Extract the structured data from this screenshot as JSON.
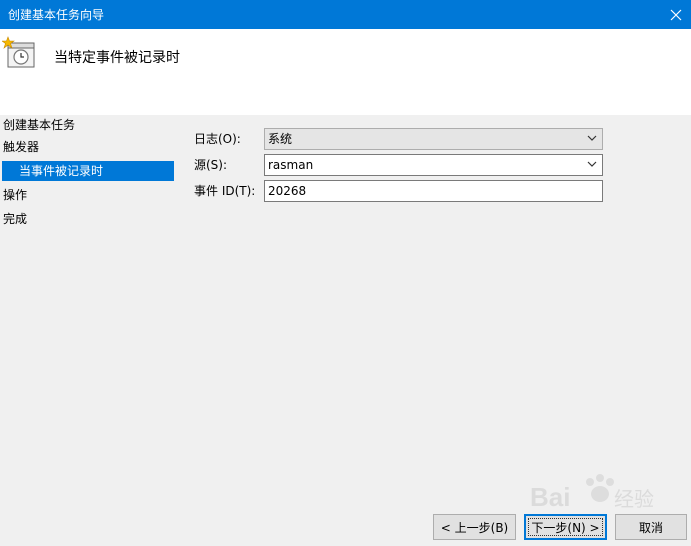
{
  "window": {
    "title": "创建基本任务向导",
    "close_glyph": "✕"
  },
  "header": {
    "title": "当特定事件被记录时"
  },
  "sidebar": {
    "items": [
      {
        "label": "创建基本任务",
        "selected": false
      },
      {
        "label": "触发器",
        "selected": false
      },
      {
        "label": "当事件被记录时",
        "selected": true
      },
      {
        "label": "操作",
        "selected": false
      },
      {
        "label": "完成",
        "selected": false
      }
    ]
  },
  "form": {
    "log": {
      "label": "日志(O):",
      "value": "系统"
    },
    "source": {
      "label": "源(S):",
      "value": "rasman"
    },
    "event_id": {
      "label": "事件 ID(T):",
      "value": "20268"
    }
  },
  "buttons": {
    "back": "< 上一步(B)",
    "next": "下一步(N) >",
    "cancel": "取消"
  },
  "colors": {
    "accent": "#0078d7",
    "background": "#f0f0f0"
  },
  "icons": {
    "header": "task-clock-icon",
    "chevron": "chevron-down-icon",
    "close": "close-icon"
  }
}
